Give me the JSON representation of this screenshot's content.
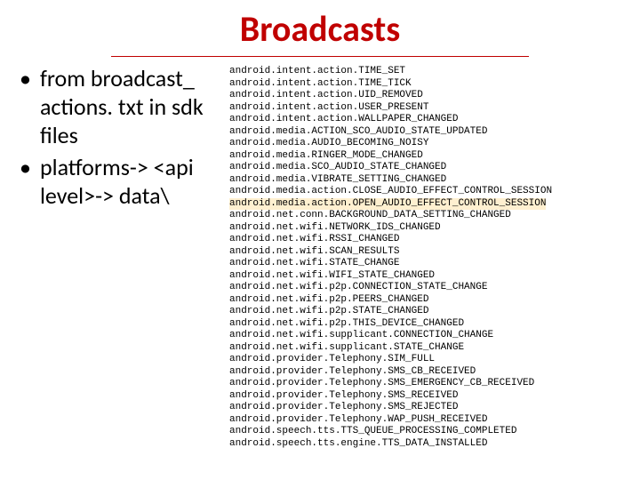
{
  "title": "Broadcasts",
  "bullets": [
    "from broadcast_ actions. txt in sdk files",
    "platforms-> <api level>-> data\\"
  ],
  "code_lines": [
    {
      "t": "android.intent.action.TIME_SET",
      "h": false
    },
    {
      "t": "android.intent.action.TIME_TICK",
      "h": false
    },
    {
      "t": "android.intent.action.UID_REMOVED",
      "h": false
    },
    {
      "t": "android.intent.action.USER_PRESENT",
      "h": false
    },
    {
      "t": "android.intent.action.WALLPAPER_CHANGED",
      "h": false
    },
    {
      "t": "android.media.ACTION_SCO_AUDIO_STATE_UPDATED",
      "h": false
    },
    {
      "t": "android.media.AUDIO_BECOMING_NOISY",
      "h": false
    },
    {
      "t": "android.media.RINGER_MODE_CHANGED",
      "h": false
    },
    {
      "t": "android.media.SCO_AUDIO_STATE_CHANGED",
      "h": false
    },
    {
      "t": "android.media.VIBRATE_SETTING_CHANGED",
      "h": false
    },
    {
      "t": "android.media.action.CLOSE_AUDIO_EFFECT_CONTROL_SESSION",
      "h": false
    },
    {
      "t": "android.media.action.OPEN_AUDIO_EFFECT_CONTROL_SESSION",
      "h": true
    },
    {
      "t": "android.net.conn.BACKGROUND_DATA_SETTING_CHANGED",
      "h": false
    },
    {
      "t": "android.net.wifi.NETWORK_IDS_CHANGED",
      "h": false
    },
    {
      "t": "android.net.wifi.RSSI_CHANGED",
      "h": false
    },
    {
      "t": "android.net.wifi.SCAN_RESULTS",
      "h": false
    },
    {
      "t": "android.net.wifi.STATE_CHANGE",
      "h": false
    },
    {
      "t": "android.net.wifi.WIFI_STATE_CHANGED",
      "h": false
    },
    {
      "t": "android.net.wifi.p2p.CONNECTION_STATE_CHANGE",
      "h": false
    },
    {
      "t": "android.net.wifi.p2p.PEERS_CHANGED",
      "h": false
    },
    {
      "t": "android.net.wifi.p2p.STATE_CHANGED",
      "h": false
    },
    {
      "t": "android.net.wifi.p2p.THIS_DEVICE_CHANGED",
      "h": false
    },
    {
      "t": "android.net.wifi.supplicant.CONNECTION_CHANGE",
      "h": false
    },
    {
      "t": "android.net.wifi.supplicant.STATE_CHANGE",
      "h": false
    },
    {
      "t": "android.provider.Telephony.SIM_FULL",
      "h": false
    },
    {
      "t": "android.provider.Telephony.SMS_CB_RECEIVED",
      "h": false
    },
    {
      "t": "android.provider.Telephony.SMS_EMERGENCY_CB_RECEIVED",
      "h": false
    },
    {
      "t": "android.provider.Telephony.SMS_RECEIVED",
      "h": false
    },
    {
      "t": "android.provider.Telephony.SMS_REJECTED",
      "h": false
    },
    {
      "t": "android.provider.Telephony.WAP_PUSH_RECEIVED",
      "h": false
    },
    {
      "t": "android.speech.tts.TTS_QUEUE_PROCESSING_COMPLETED",
      "h": false
    },
    {
      "t": "android.speech.tts.engine.TTS_DATA_INSTALLED",
      "h": false
    }
  ]
}
